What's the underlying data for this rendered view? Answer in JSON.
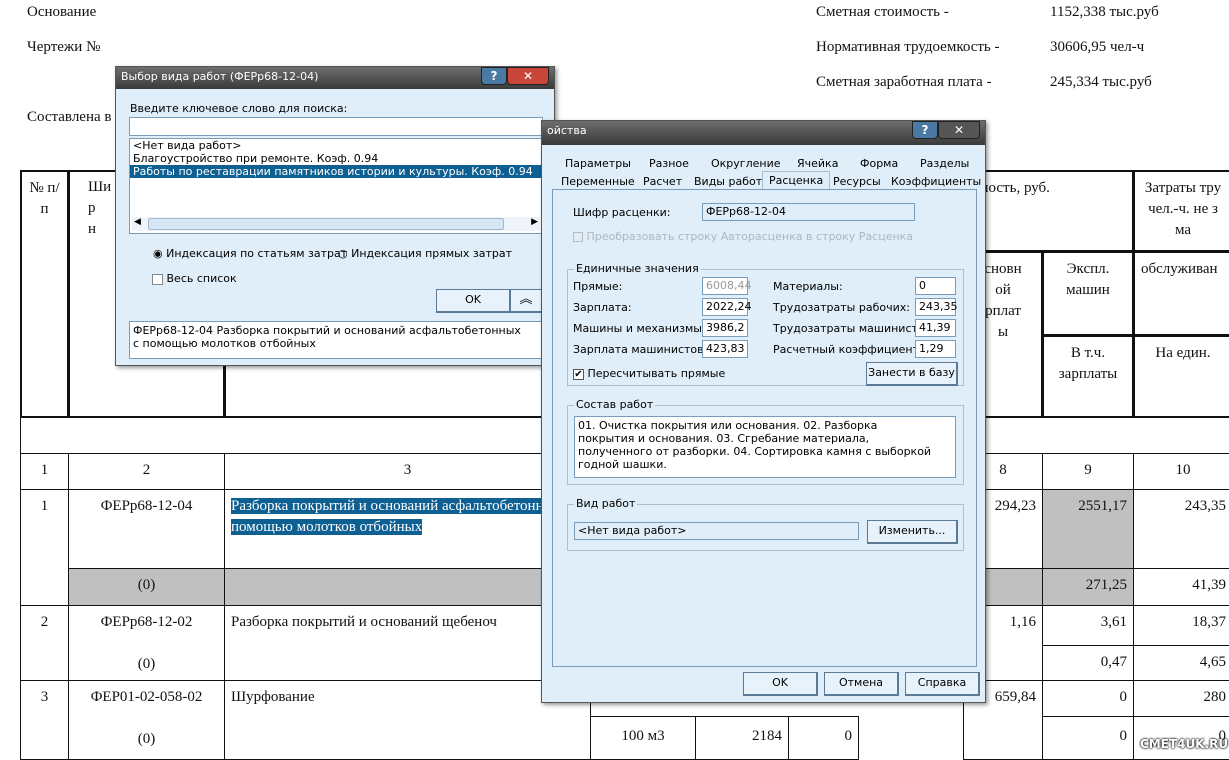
{
  "document": {
    "basis_label": "Основание",
    "drawings_label": "Чертежи №",
    "composed_label": "Составлена в",
    "summary": [
      {
        "label": "Сметная стоимость -",
        "value": "1152,338 тыс.руб"
      },
      {
        "label": "Нормативная трудоемкость -",
        "value": "30606,95 чел-ч"
      },
      {
        "label": "Сметная заработная плата -",
        "value": "245,334 тыс.руб"
      }
    ],
    "headers": {
      "num": "№ п/п",
      "code": "Ши\nр\nн",
      "cost": "имость, руб.",
      "labor": "Затраты тру\nчел.-ч. не з\nма",
      "base_salary": "сновн\nой\nрплат\nы",
      "machines": "Экспл.\nмашин",
      "service": "обслуживан",
      "incl_salary": "В т.ч.\nзарплаты",
      "per_unit": "На един."
    },
    "col_numbers": [
      "1",
      "2",
      "3",
      "8",
      "9",
      "10"
    ],
    "rows": [
      {
        "num": "1",
        "code": "ФЕРр68-12-04",
        "sub": "(0)",
        "name": "Разборка покрытий и оснований асфальтобетонных с помощью молотков отбойных",
        "c8": "294,23",
        "c9": "2551,17",
        "c9b": "271,25",
        "c10": "243,35",
        "c10b": "41,39"
      },
      {
        "num": "2",
        "code": "ФЕРр68-12-02",
        "sub": "(0)",
        "name": "Разборка покрытий и оснований щебеноч",
        "c8": "1,16",
        "c9": "3,61",
        "c9b": "0,47",
        "c10": "18,37",
        "c10b": "4,65"
      },
      {
        "num": "3",
        "code": "ФЕР01-02-058-02",
        "sub": "(0)",
        "name": "Шурфование",
        "unit": "100 м3",
        "qty": "2184",
        "c7": "0",
        "c8": "659,84",
        "c9": "0",
        "c9b": "0",
        "c10": "280",
        "c10b": "0"
      }
    ],
    "watermark": "СМЕТ4UK.RU"
  },
  "work_type_dialog": {
    "title": "Выбор вида работ (ФЕРр68-12-04)",
    "search_label": "Введите ключевое слово для поиска:",
    "search_value": "",
    "items": [
      "<Нет вида работ>",
      "Благоустройство при ремонте. Коэф. 0.94",
      "Работы по реставрации памятников истории и культуры. Коэф. 0.94"
    ],
    "selected_index": 2,
    "radio_by_cost": "Индексация по статьям затрат",
    "radio_direct": "Индексация прямых затрат",
    "radio_selected": "by_cost",
    "full_list_label": "Весь список",
    "full_list_checked": false,
    "ok": "OK",
    "description": "ФЕРр68-12-04  Разборка покрытий и оснований асфальтобетонных с помощью молотков отбойных"
  },
  "properties_dialog": {
    "title": "ойства",
    "tabs_row1": [
      "Параметры",
      "Разное",
      "Округление",
      "Ячейка",
      "Форма",
      "Разделы"
    ],
    "tabs_row2": [
      "Переменные",
      "Расчет",
      "Виды работ",
      "Расценка",
      "Ресурсы",
      "Коэффициенты"
    ],
    "active_tab": "Расценка",
    "code_label": "Шифр расценки:",
    "code_value": "ФЕРр68-12-04",
    "convert_label": "Преобразовать строку  Авторасценка в строку Расценка",
    "unit_group": "Единичные значения",
    "left_fields": [
      {
        "label": "Прямые:",
        "value": "6008,44"
      },
      {
        "label": "Зарплата:",
        "value": "2022,24"
      },
      {
        "label": "Машины и механизмы:",
        "value": "3986,2"
      },
      {
        "label": "Зарплата машинистов:",
        "value": "423,83"
      }
    ],
    "right_fields": [
      {
        "label": "Материалы:",
        "value": "0"
      },
      {
        "label": "Трудозатраты рабочих:",
        "value": "243,35"
      },
      {
        "label": "Трудозатраты машинистов:",
        "value": "41,39"
      },
      {
        "label": "Расчетный коэффициент:",
        "value": "1,29"
      }
    ],
    "recalc_label": "Пересчитывать прямые",
    "recalc_checked": true,
    "save_db": "Занести в базу",
    "composition_group": "Состав работ",
    "composition": "01. Очистка покрытия или основания. 02. Разборка покрытия и основания. 03. Сгребание материала, полученного от разборки. 04. Сортировка камня с выборкой годной шашки.",
    "work_type_group": "Вид работ",
    "work_type_value": "<Нет вида работ>",
    "change": "Изменить...",
    "ok": "OK",
    "cancel": "Отмена",
    "help": "Справка"
  }
}
